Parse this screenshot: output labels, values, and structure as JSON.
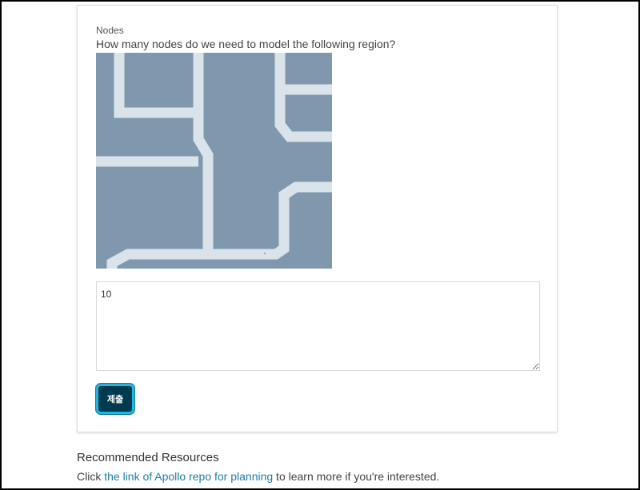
{
  "question": {
    "label": "Nodes",
    "prompt": "How many nodes do we need to model the following region?",
    "answer_value": "10",
    "submit_label": "제출"
  },
  "map_image": {
    "background_color": "#7f98ae",
    "road_color": "#dbe3ea"
  },
  "resources": {
    "title": "Recommended Resources",
    "prefix": "Click ",
    "link_text": "the link of Apollo repo for planning",
    "suffix": " to learn more if you're interested.",
    "link_color": "#1a7fa8"
  }
}
